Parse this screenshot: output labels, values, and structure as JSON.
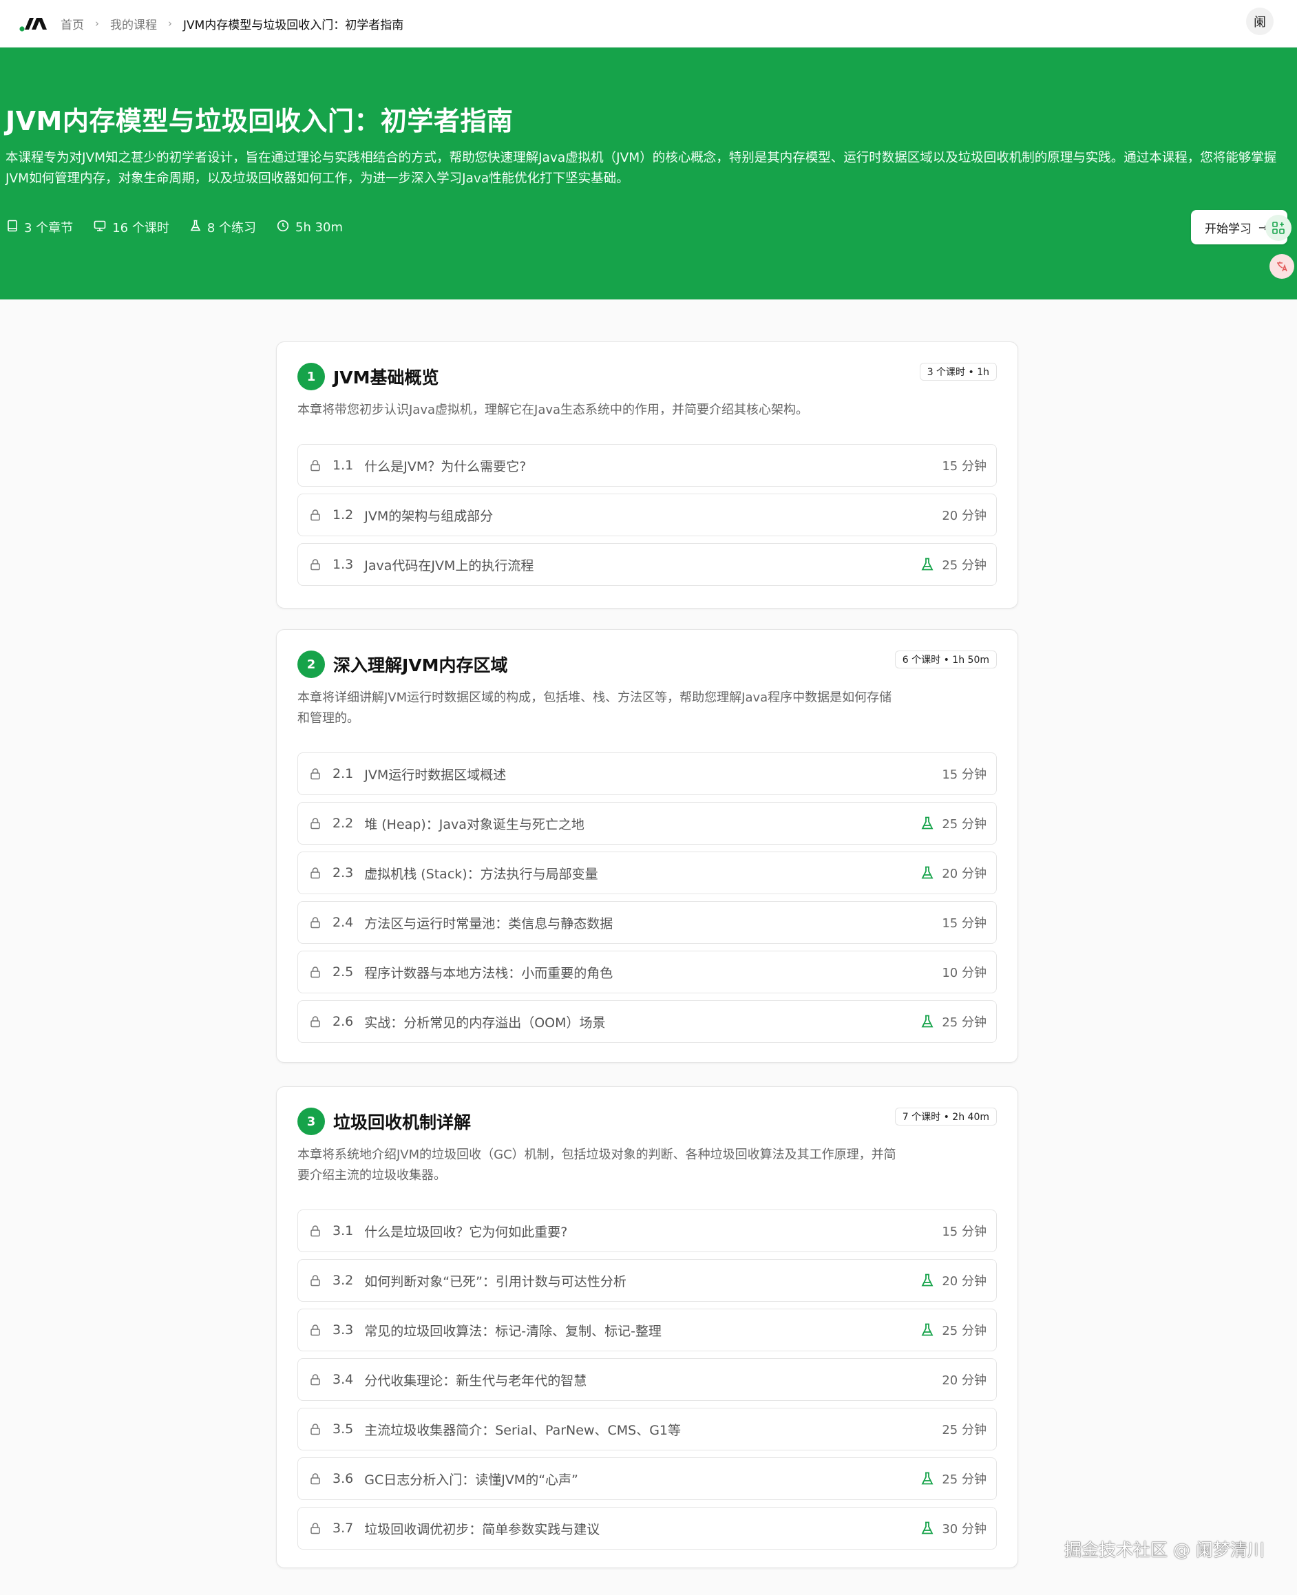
{
  "nav": {
    "breadcrumbs": [
      "首页",
      "我的课程",
      "JVM内存模型与垃圾回收入门：初学者指南"
    ],
    "avatar_text": "阑"
  },
  "hero": {
    "title": "JVM内存模型与垃圾回收入门：初学者指南",
    "description": "本课程专为对JVM知之甚少的初学者设计，旨在通过理论与实践相结合的方式，帮助您快速理解Java虚拟机（JVM）的核心概念，特别是其内存模型、运行时数据区域以及垃圾回收机制的原理与实践。通过本课程，您将能够掌握JVM如何管理内存，对象生命周期，以及垃圾回收器如何工作，为进一步深入学习Java性能优化打下坚实基础。",
    "meta": {
      "chapters": "3 个章节",
      "lessons": "16 个课时",
      "exercises": "8 个练习",
      "duration": "5h 30m"
    },
    "start_button": "开始学习",
    "accent_color": "#16a34a"
  },
  "chapters": [
    {
      "number": "1",
      "title": "JVM基础概览",
      "badge": "3 个课时 • 1h",
      "description": "本章将带您初步认识Java虚拟机，理解它在Java生态系统中的作用，并简要介绍其核心架构。",
      "lessons": [
        {
          "num": "1.1",
          "title": "什么是JVM？为什么需要它?",
          "duration": "15 分钟",
          "exercise": false
        },
        {
          "num": "1.2",
          "title": "JVM的架构与组成部分",
          "duration": "20 分钟",
          "exercise": false
        },
        {
          "num": "1.3",
          "title": "Java代码在JVM上的执行流程",
          "duration": "25 分钟",
          "exercise": true
        }
      ]
    },
    {
      "number": "2",
      "title": "深入理解JVM内存区域",
      "badge": "6 个课时 • 1h 50m",
      "description": "本章将详细讲解JVM运行时数据区域的构成，包括堆、栈、方法区等，帮助您理解Java程序中数据是如何存储和管理的。",
      "lessons": [
        {
          "num": "2.1",
          "title": "JVM运行时数据区域概述",
          "duration": "15 分钟",
          "exercise": false
        },
        {
          "num": "2.2",
          "title": "堆 (Heap)：Java对象诞生与死亡之地",
          "duration": "25 分钟",
          "exercise": true
        },
        {
          "num": "2.3",
          "title": "虚拟机栈 (Stack)：方法执行与局部变量",
          "duration": "20 分钟",
          "exercise": true
        },
        {
          "num": "2.4",
          "title": "方法区与运行时常量池：类信息与静态数据",
          "duration": "15 分钟",
          "exercise": false
        },
        {
          "num": "2.5",
          "title": "程序计数器与本地方法栈：小而重要的角色",
          "duration": "10 分钟",
          "exercise": false
        },
        {
          "num": "2.6",
          "title": "实战：分析常见的内存溢出（OOM）场景",
          "duration": "25 分钟",
          "exercise": true
        }
      ]
    },
    {
      "number": "3",
      "title": "垃圾回收机制详解",
      "badge": "7 个课时 • 2h 40m",
      "description": "本章将系统地介绍JVM的垃圾回收（GC）机制，包括垃圾对象的判断、各种垃圾回收算法及其工作原理，并简要介绍主流的垃圾收集器。",
      "lessons": [
        {
          "num": "3.1",
          "title": "什么是垃圾回收？它为何如此重要?",
          "duration": "15 分钟",
          "exercise": false
        },
        {
          "num": "3.2",
          "title": "如何判断对象“已死”：引用计数与可达性分析",
          "duration": "20 分钟",
          "exercise": true
        },
        {
          "num": "3.3",
          "title": "常见的垃圾回收算法：标记-清除、复制、标记-整理",
          "duration": "25 分钟",
          "exercise": true
        },
        {
          "num": "3.4",
          "title": "分代收集理论：新生代与老年代的智慧",
          "duration": "20 分钟",
          "exercise": false
        },
        {
          "num": "3.5",
          "title": "主流垃圾收集器简介：Serial、ParNew、CMS、G1等",
          "duration": "25 分钟",
          "exercise": false
        },
        {
          "num": "3.6",
          "title": "GC日志分析入门：读懂JVM的“心声”",
          "duration": "25 分钟",
          "exercise": true
        },
        {
          "num": "3.7",
          "title": "垃圾回收调优初步：简单参数实践与建议",
          "duration": "30 分钟",
          "exercise": true
        }
      ]
    }
  ],
  "watermark": "掘金技术社区 @ 阑梦清川"
}
